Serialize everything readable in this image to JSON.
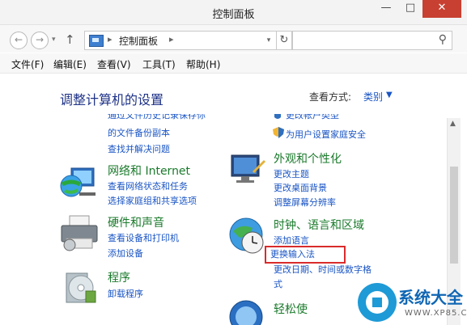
{
  "window": {
    "title": "控制面板",
    "minimize": "—",
    "maximize": "□",
    "close": "✕"
  },
  "nav": {
    "back": "←",
    "forward": "→",
    "dropdown": "▾",
    "up": "↑",
    "crumb_sep": "▸",
    "crumb": "控制面板",
    "refresh": "↻",
    "search_placeholder": "",
    "search_icon": "⚲"
  },
  "menu": [
    "文件(F)",
    "编辑(E)",
    "查看(V)",
    "工具(T)",
    "帮助(H)"
  ],
  "main": {
    "heading": "调整计算机的设置",
    "view_by_label": "查看方式:",
    "view_by_value": "类别",
    "view_by_arrow": "▼"
  },
  "left": {
    "partial_top": "通过文件历史记录保存你",
    "backup_link": "的文件备份副本",
    "troubleshoot_link": "查找并解决问题",
    "network": {
      "title": "网络和 Internet",
      "links": [
        "查看网络状态和任务",
        "选择家庭组和共享选项"
      ]
    },
    "hardware": {
      "title": "硬件和声音",
      "links": [
        "查看设备和打印机",
        "添加设备"
      ]
    },
    "programs": {
      "title": "程序",
      "links": [
        "卸载程序"
      ]
    }
  },
  "right": {
    "partial_top": "更改帐户类型",
    "family_link": "为用户设置家庭安全",
    "appearance": {
      "title": "外观和个性化",
      "links": [
        "更改主题",
        "更改桌面背景",
        "调整屏幕分辨率"
      ]
    },
    "clock": {
      "title": "时钟、语言和区域",
      "links": [
        "添加语言",
        "更换输入法",
        "更改日期、时间或数字格",
        "式"
      ]
    },
    "ease": {
      "title": "轻松使"
    }
  },
  "watermark": {
    "text": "系统大全",
    "url": "WWW.XP85.COM"
  }
}
